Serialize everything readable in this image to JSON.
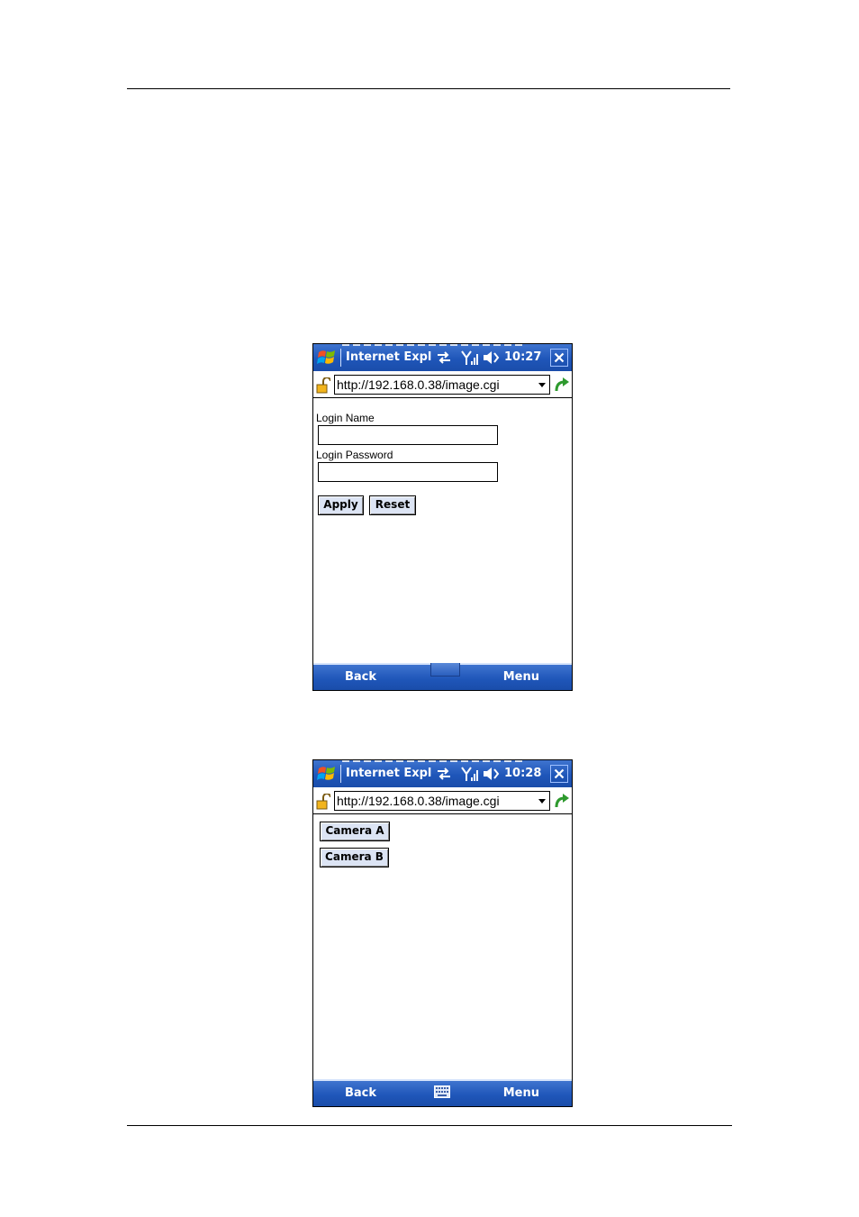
{
  "screens": [
    {
      "title": "Internet Explo",
      "clock": "10:27",
      "address": "http://192.168.0.38/image.cgi",
      "form": {
        "login_name_label": "Login Name",
        "login_name_value": "",
        "login_password_label": "Login Password",
        "login_password_value": "",
        "apply_label": "Apply",
        "reset_label": "Reset"
      },
      "softkeys": {
        "left": "Back",
        "right": "Menu"
      },
      "icons": [
        "windows-start-icon",
        "connectivity-icon",
        "signal-icon",
        "volume-muted-icon",
        "close-icon",
        "lock-icon",
        "go-arrow-icon",
        "keyboard-icon"
      ]
    },
    {
      "title": "Internet Explo",
      "clock": "10:28",
      "address": "http://192.168.0.38/image.cgi",
      "cameras": [
        "Camera A",
        "Camera B"
      ],
      "softkeys": {
        "left": "Back",
        "right": "Menu"
      },
      "icons": [
        "windows-start-icon",
        "connectivity-icon",
        "signal-icon",
        "volume-muted-icon",
        "close-icon",
        "lock-icon",
        "go-arrow-icon",
        "keyboard-icon"
      ]
    }
  ],
  "colors": {
    "titlebar": "#1f56b9",
    "button_face": "#dce4f4"
  }
}
